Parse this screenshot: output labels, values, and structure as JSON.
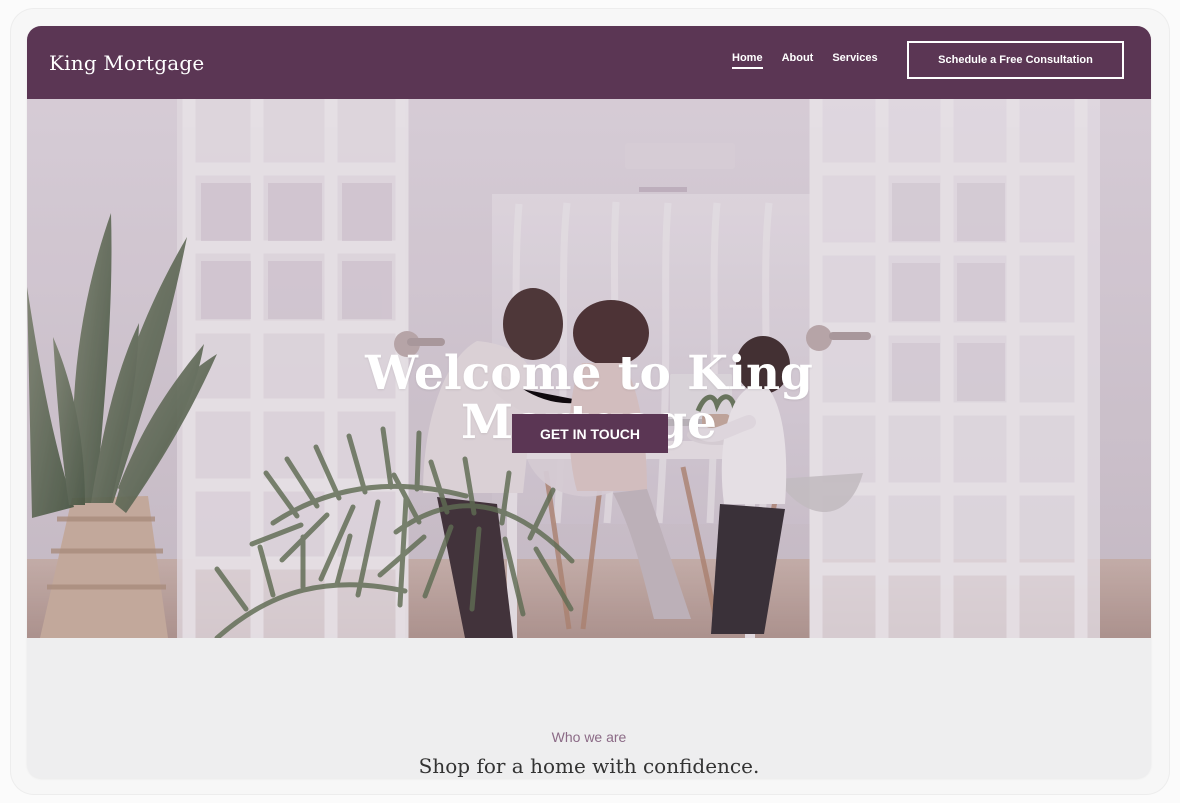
{
  "site": {
    "brand": "King Mortgage",
    "nav": {
      "items": [
        {
          "label": "Home",
          "active": true
        },
        {
          "label": "About",
          "active": false
        },
        {
          "label": "Services",
          "active": false
        }
      ],
      "cta": "Schedule a Free Consultation"
    },
    "hero": {
      "title_lines": [
        "Welcome to King",
        "Mortgage"
      ],
      "button": "GET IN TOUCH"
    },
    "section": {
      "kicker": "Who we are",
      "heading": "Shop for a home with confidence."
    },
    "colors": {
      "brand": "#5b3654",
      "text_on_brand": "#ffffff",
      "section_bg": "#eeeeef",
      "kicker": "#8b6a86",
      "heading": "#333333"
    }
  }
}
